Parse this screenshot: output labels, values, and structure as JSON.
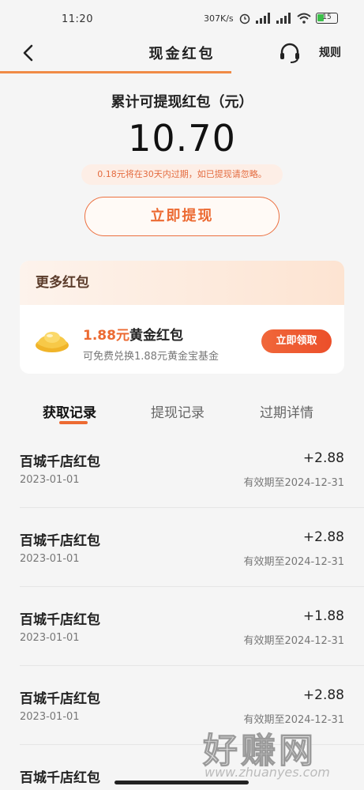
{
  "status_bar": {
    "time": "11:20",
    "net_speed": "307K/s",
    "battery": "15"
  },
  "header": {
    "title": "现金红包",
    "rule_label": "规则"
  },
  "summary": {
    "label": "累计可提现红包（元）",
    "amount": "10.70",
    "expire_note": "0.18元将在30天内过期，如已提现请忽略。",
    "withdraw_button": "立即提现"
  },
  "more_card": {
    "title": "更多红包",
    "gold_amount": "1.88元",
    "gold_name": "黄金红包",
    "gold_desc": "可免费兑换1.88元黄金宝基金",
    "claim_button": "立即领取"
  },
  "tabs": [
    {
      "label": "获取记录",
      "active": true
    },
    {
      "label": "提现记录",
      "active": false
    },
    {
      "label": "过期详情",
      "active": false
    }
  ],
  "records": [
    {
      "name": "百城千店红包",
      "date": "2023-01-01",
      "value": "+2.88",
      "expiry": "有效期至2024-12-31"
    },
    {
      "name": "百城千店红包",
      "date": "2023-01-01",
      "value": "+2.88",
      "expiry": "有效期至2024-12-31"
    },
    {
      "name": "百城千店红包",
      "date": "2023-01-01",
      "value": "+1.88",
      "expiry": "有效期至2024-12-31"
    },
    {
      "name": "百城千店红包",
      "date": "2023-01-01",
      "value": "+2.88",
      "expiry": "有效期至2024-12-31"
    },
    {
      "name": "百城千店红包",
      "date": "",
      "value": "",
      "expiry": ""
    }
  ],
  "watermark": {
    "big": "好赚网",
    "url": "www.zhuanyes.com"
  },
  "colors": {
    "accent": "#ec6a32",
    "accent_light": "#fdeee6",
    "card_head": "#fde4d2",
    "background": "#f5f5f5"
  },
  "icons": [
    "back-arrow-icon",
    "headset-icon",
    "gold-ingot-icon",
    "wifi-icon",
    "signal-icon",
    "battery-icon"
  ]
}
